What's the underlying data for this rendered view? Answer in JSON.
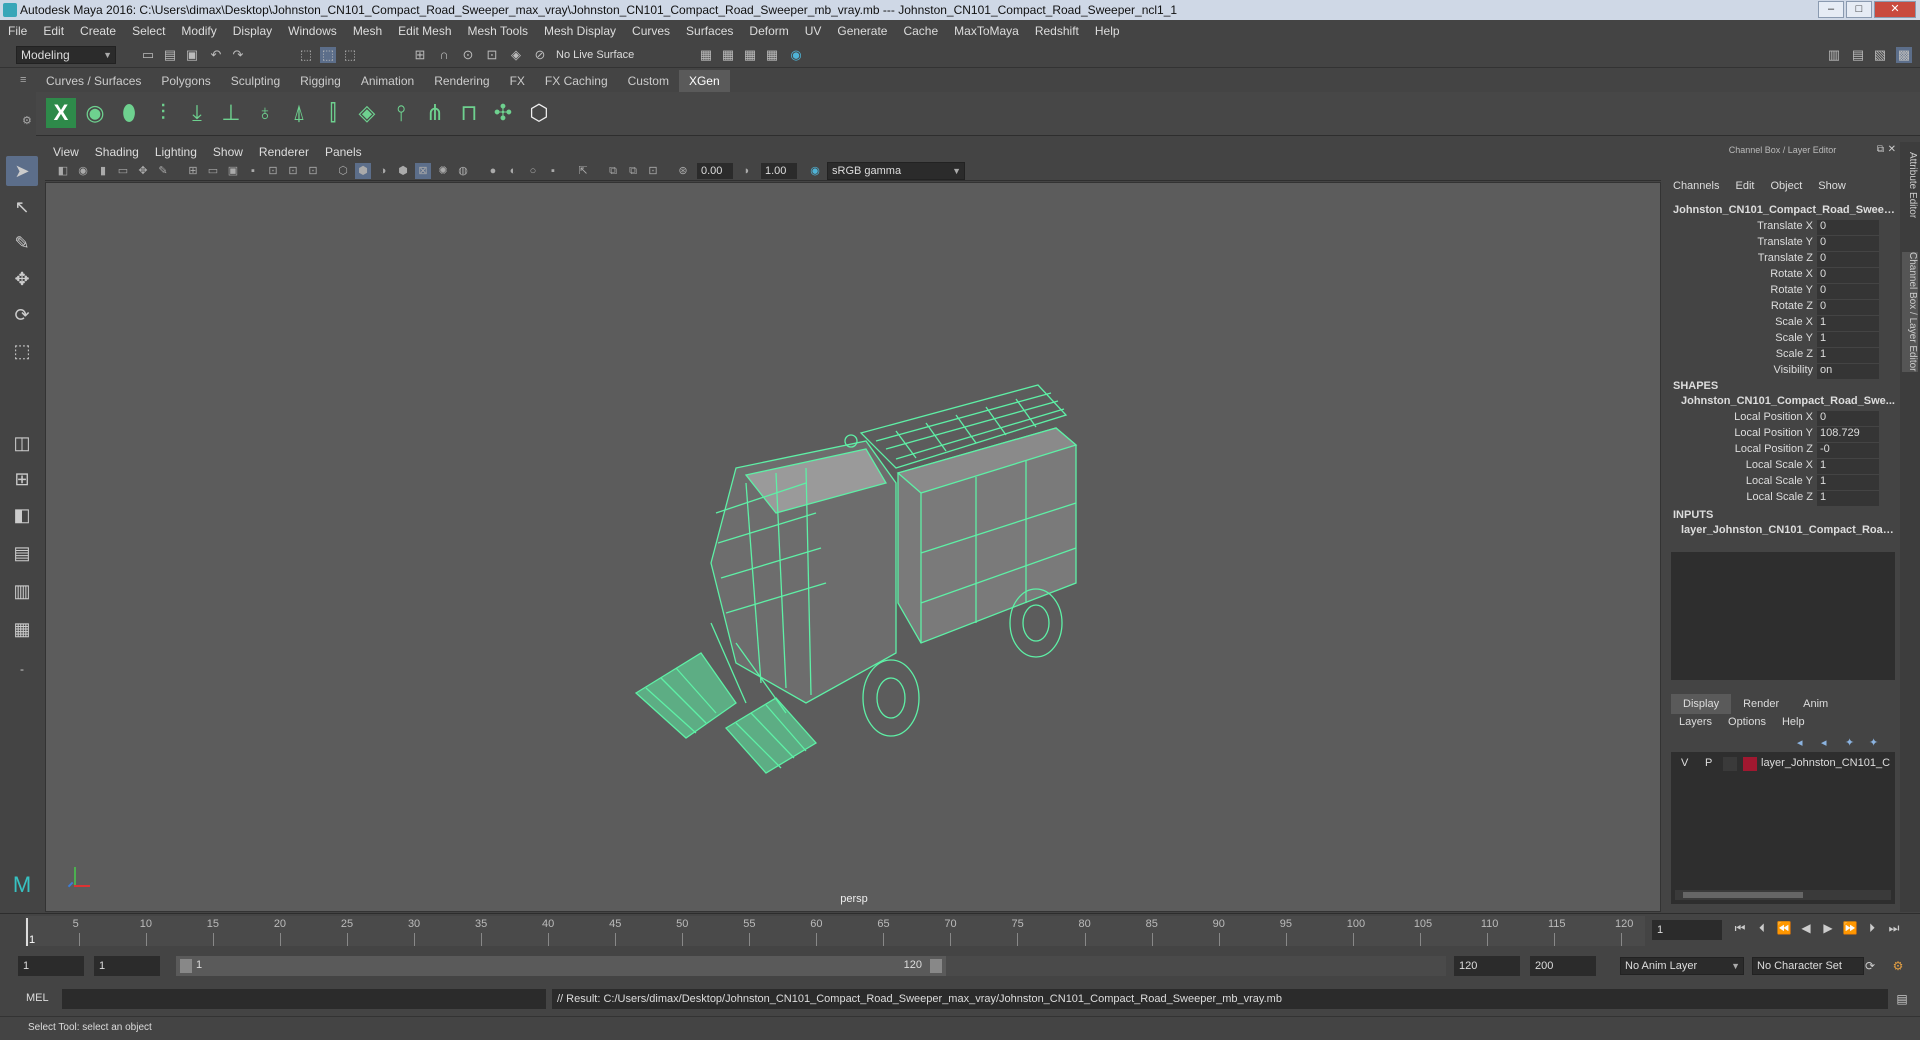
{
  "window": {
    "title": "Autodesk Maya 2016: C:\\Users\\dimax\\Desktop\\Johnston_CN101_Compact_Road_Sweeper_max_vray\\Johnston_CN101_Compact_Road_Sweeper_mb_vray.mb   ---   Johnston_CN101_Compact_Road_Sweeper_ncl1_1",
    "minimize": "–",
    "maximize": "□",
    "close": "✕"
  },
  "menubar": [
    "File",
    "Edit",
    "Create",
    "Select",
    "Modify",
    "Display",
    "Windows",
    "Mesh",
    "Edit Mesh",
    "Mesh Tools",
    "Mesh Display",
    "Curves",
    "Surfaces",
    "Deform",
    "UV",
    "Generate",
    "Cache",
    "MaxToMaya",
    "Redshift",
    "Help"
  ],
  "statusline": {
    "mode": "Modeling",
    "live_surface": "No Live Surface"
  },
  "shelf_tabs": [
    {
      "label": "Curves / Surfaces",
      "active": false
    },
    {
      "label": "Polygons",
      "active": false
    },
    {
      "label": "Sculpting",
      "active": false
    },
    {
      "label": "Rigging",
      "active": false
    },
    {
      "label": "Animation",
      "active": false
    },
    {
      "label": "Rendering",
      "active": false
    },
    {
      "label": "FX",
      "active": false
    },
    {
      "label": "FX Caching",
      "active": false
    },
    {
      "label": "Custom",
      "active": false
    },
    {
      "label": "XGen",
      "active": true
    }
  ],
  "viewport": {
    "menu": [
      "View",
      "Shading",
      "Lighting",
      "Show",
      "Renderer",
      "Panels"
    ],
    "exposure": "0.00",
    "gamma": "1.00",
    "colorspace": "sRGB gamma",
    "camera_label": "persp",
    "wire_color": "#5ef0a6"
  },
  "channel_box": {
    "header": "Channel Box / Layer Editor",
    "menu": [
      "Channels",
      "Edit",
      "Object",
      "Show"
    ],
    "object_name": "Johnston_CN101_Compact_Road_Sweep...",
    "channels": [
      {
        "label": "Translate X",
        "value": "0"
      },
      {
        "label": "Translate Y",
        "value": "0"
      },
      {
        "label": "Translate Z",
        "value": "0"
      },
      {
        "label": "Rotate X",
        "value": "0"
      },
      {
        "label": "Rotate Y",
        "value": "0"
      },
      {
        "label": "Rotate Z",
        "value": "0"
      },
      {
        "label": "Scale X",
        "value": "1"
      },
      {
        "label": "Scale Y",
        "value": "1"
      },
      {
        "label": "Scale Z",
        "value": "1"
      },
      {
        "label": "Visibility",
        "value": "on"
      }
    ],
    "shapes_header": "SHAPES",
    "shape_name": "Johnston_CN101_Compact_Road_Swe...",
    "shape_channels": [
      {
        "label": "Local Position X",
        "value": "0"
      },
      {
        "label": "Local Position Y",
        "value": "108.729"
      },
      {
        "label": "Local Position Z",
        "value": "-0"
      },
      {
        "label": "Local Scale X",
        "value": "1"
      },
      {
        "label": "Local Scale Y",
        "value": "1"
      },
      {
        "label": "Local Scale Z",
        "value": "1"
      }
    ],
    "inputs_header": "INPUTS",
    "input_name": "layer_Johnston_CN101_Compact_Road..."
  },
  "layer_editor": {
    "tabs": [
      "Display",
      "Render",
      "Anim"
    ],
    "active_tab": "Display",
    "menu": [
      "Layers",
      "Options",
      "Help"
    ],
    "layer": {
      "v": "V",
      "p": "P",
      "name": "layer_Johnston_CN101_C",
      "color": "#a01830"
    }
  },
  "side_tabs": [
    "Attribute Editor",
    "Channel Box / Layer Editor"
  ],
  "timeline": {
    "ticks": [
      "5",
      "10",
      "15",
      "20",
      "25",
      "30",
      "35",
      "40",
      "45",
      "50",
      "55",
      "60",
      "65",
      "70",
      "75",
      "80",
      "85",
      "90",
      "95",
      "100",
      "105",
      "110",
      "115",
      "120"
    ],
    "start_label": "1",
    "current_frame": "1"
  },
  "range": {
    "start": "1",
    "playback_start": "1",
    "range_start_label": "1",
    "range_end_label": "120",
    "playback_end": "120",
    "end": "200",
    "anim_layer": "No Anim Layer",
    "character_set": "No Character Set"
  },
  "command": {
    "mode": "MEL",
    "result": "// Result: C:/Users/dimax/Desktop/Johnston_CN101_Compact_Road_Sweeper_max_vray/Johnston_CN101_Compact_Road_Sweeper_mb_vray.mb"
  },
  "helpline": "Select Tool: select an object"
}
